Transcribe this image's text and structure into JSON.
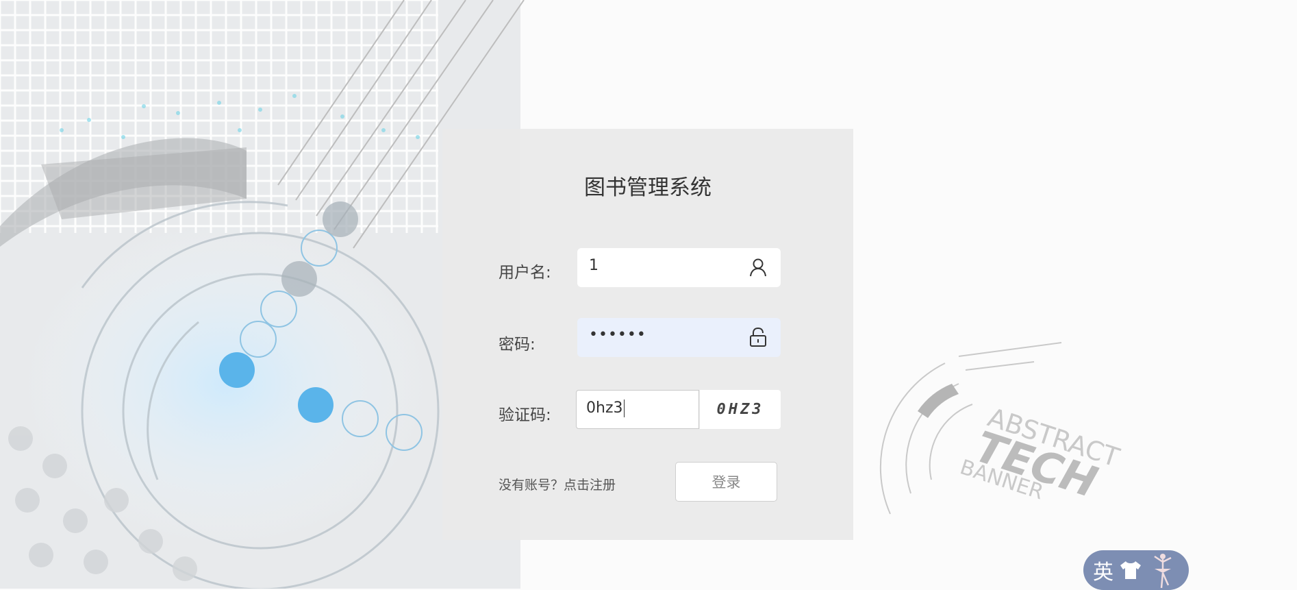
{
  "login": {
    "title": "图书管理系统",
    "username_label": "用户名:",
    "username_value": "1",
    "password_label": "密码:",
    "password_value": "••••••",
    "captcha_label": "验证码:",
    "captcha_value": "0hz3",
    "captcha_image_text": "0HZ3",
    "register_text": "没有账号？点击注册",
    "login_button": "登录"
  },
  "background": {
    "watermark_line1": "ABSTRACT",
    "watermark_line2": "TECH",
    "watermark_line3": "BANNER"
  },
  "ime": {
    "mode": "英",
    "icons": [
      "shirt-icon",
      "ballerina-icon"
    ]
  },
  "colors": {
    "panel": "#eaeaea",
    "password_field": "#eaf0fc",
    "ime_badge": "#7d8eb3",
    "accent_dot": "#5ab4ea"
  }
}
